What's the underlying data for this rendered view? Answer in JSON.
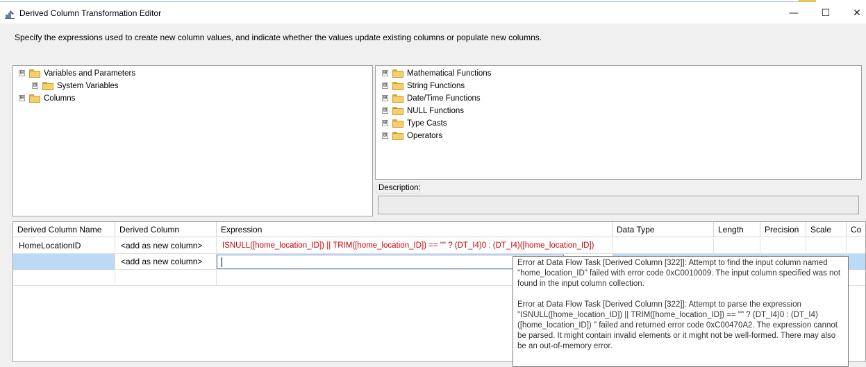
{
  "window": {
    "title": "Derived Column Transformation Editor",
    "minimize_icon": "minimize-icon",
    "maximize_icon": "maximize-icon",
    "close_icon": "close-icon",
    "minimize_glyph": "—",
    "maximize_glyph": "☐",
    "close_glyph": "✕"
  },
  "instructions": "Specify the expressions used to create new column values, and indicate whether the values update existing columns or populate new columns.",
  "left_tree": [
    {
      "label": "Variables and Parameters",
      "expander": "⊟",
      "level": 0,
      "open": true
    },
    {
      "label": "System Variables",
      "expander": "⊞",
      "level": 1,
      "open": false
    },
    {
      "label": "Columns",
      "expander": "⊞",
      "level": 0,
      "open": false
    }
  ],
  "right_tree": [
    {
      "label": "Mathematical Functions",
      "expander": "⊞"
    },
    {
      "label": "String Functions",
      "expander": "⊞"
    },
    {
      "label": "Date/Time Functions",
      "expander": "⊞"
    },
    {
      "label": "NULL Functions",
      "expander": "⊞"
    },
    {
      "label": "Type Casts",
      "expander": "⊞"
    },
    {
      "label": "Operators",
      "expander": "⊞"
    }
  ],
  "description": {
    "label": "Description:",
    "value": ""
  },
  "grid": {
    "columns": [
      "Derived Column Name",
      "Derived Column",
      "Expression",
      "Data Type",
      "Length",
      "Precision",
      "Scale",
      "Co"
    ],
    "rows": [
      {
        "name": "HomeLocationID",
        "derived": "<add as new column>",
        "expression": "ISNULL([home_location_ID]) || TRIM([home_location_ID]) == \"\" ? (DT_I4)0 : (DT_I4)([home_location_ID])"
      },
      {
        "name": "",
        "derived": "<add as new column>",
        "expression": ""
      }
    ]
  },
  "tooltip": {
    "error1": "Error at Data Flow Task [Derived Column [322]]: Attempt to find the input column named \"home_location_ID\" failed with error code 0xC0010009. The input column specified was not found in the input column collection.",
    "error2": "Error at Data Flow Task [Derived Column [322]]: Attempt to parse the expression \"ISNULL([home_location_ID]) || TRIM([home_location_ID]) == \"\" ? (DT_I4)0 : (DT_I4)([home_location_ID]) \" failed and returned error code 0xC00470A2. The expression cannot be parsed. It might contain invalid elements or it might not be well-formed. There may also be an out-of-memory error."
  }
}
